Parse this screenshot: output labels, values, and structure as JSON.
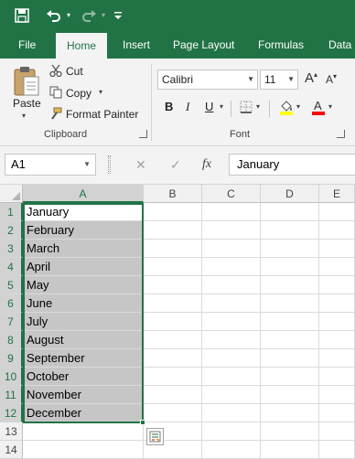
{
  "qat": {
    "save_icon": "save-icon",
    "undo_icon": "undo-icon",
    "redo_icon": "redo-icon",
    "customize_icon": "customize-qat-icon"
  },
  "tabs": [
    {
      "label": "File"
    },
    {
      "label": "Home"
    },
    {
      "label": "Insert"
    },
    {
      "label": "Page Layout"
    },
    {
      "label": "Formulas"
    },
    {
      "label": "Data"
    }
  ],
  "ribbon": {
    "clipboard": {
      "paste_label": "Paste",
      "cut_label": "Cut",
      "copy_label": "Copy",
      "format_painter_label": "Format Painter",
      "group_label": "Clipboard"
    },
    "font": {
      "font_name": "Calibri",
      "font_size": "11",
      "bold": "B",
      "italic": "I",
      "underline": "U",
      "grow_font": "A",
      "shrink_font": "A",
      "group_label": "Font",
      "fill_color": "#FFFF00",
      "font_color": "#FF0000"
    }
  },
  "formula_bar": {
    "name_box": "A1",
    "cancel": "✕",
    "enter": "✓",
    "fx": "fx",
    "value": "January"
  },
  "grid": {
    "columns": [
      "A",
      "B",
      "C",
      "D",
      "E"
    ],
    "rows": [
      "1",
      "2",
      "3",
      "4",
      "5",
      "6",
      "7",
      "8",
      "9",
      "10",
      "11",
      "12",
      "13",
      "14"
    ],
    "col_a": [
      "January",
      "February",
      "March",
      "April",
      "May",
      "June",
      "July",
      "August",
      "September",
      "October",
      "November",
      "December",
      "",
      ""
    ]
  },
  "colors": {
    "excel_green": "#217346",
    "selection_fill": "#C6C6C6"
  }
}
